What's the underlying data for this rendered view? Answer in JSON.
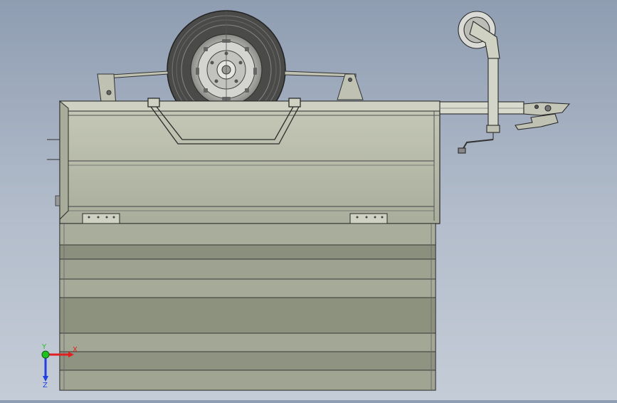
{
  "view": {
    "background_top": "#8f9db2",
    "background_bottom": "#c4ccd7",
    "body_fill": "#bcbfae",
    "body_dark": "#9ea391",
    "outline": "#2a2a2a"
  },
  "triad": {
    "x_label": "X",
    "y_label": "Y",
    "z_label": "Z",
    "x_color": "#e02020",
    "y_color": "#20c020",
    "z_color": "#2040e0"
  }
}
